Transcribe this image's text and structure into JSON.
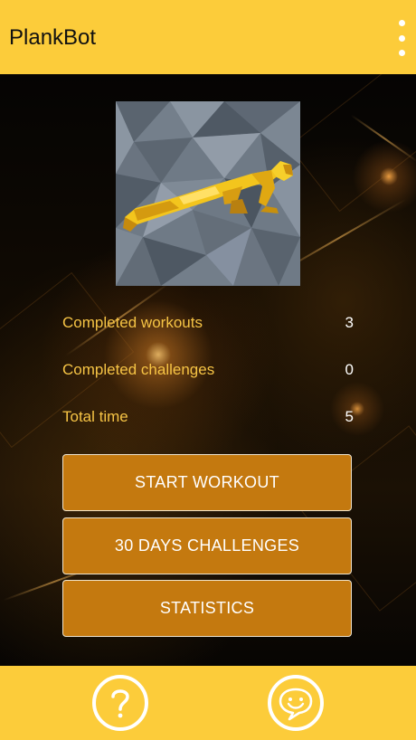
{
  "app": {
    "title": "PlankBot"
  },
  "header": {
    "menu_icon": "more-vertical-icon"
  },
  "hero_image": {
    "icon": "plank-figure-image"
  },
  "stats": [
    {
      "label": "Completed workouts",
      "value": "3"
    },
    {
      "label": "Completed challenges",
      "value": "0"
    },
    {
      "label": "Total time",
      "value": "5"
    }
  ],
  "buttons": {
    "start_workout": "START WORKOUT",
    "challenges": "30 DAYS CHALLENGES",
    "statistics": "STATISTICS"
  },
  "footer": {
    "help_icon": "question-mark-icon",
    "feedback_icon": "chat-smiley-icon"
  },
  "colors": {
    "accent": "#fccc3a",
    "button": "#c4790f",
    "label": "#f6c445"
  }
}
